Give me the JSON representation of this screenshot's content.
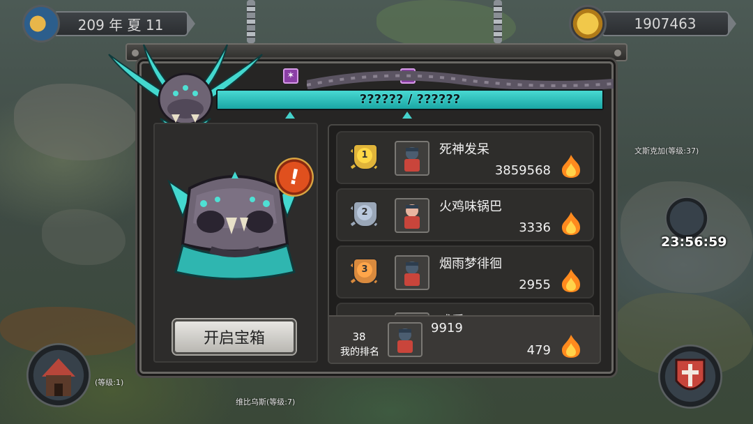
{
  "hud": {
    "date": "209 年 夏 11",
    "gold": "1907463",
    "season_icon": "sun-moon-icon",
    "gold_icon": "gold-coin-icon"
  },
  "boss": {
    "hp_text": "?????? / ??????",
    "hp_fraction": 1.0,
    "buff_icons": [
      "purple-buff-icon",
      "purple-buff-icon"
    ]
  },
  "chest": {
    "open_button": "开启宝箱",
    "alert_icon": "exclamation-icon"
  },
  "leaderboard": {
    "rows": [
      {
        "rank": "1",
        "name": "死神发呆",
        "score": "3859568",
        "medal": "gold"
      },
      {
        "rank": "2",
        "name": "火鸡味锅巴",
        "score": "3336",
        "medal": "silver"
      },
      {
        "rank": "3",
        "name": "烟雨梦徘徊",
        "score": "2955",
        "medal": "bronze"
      },
      {
        "rank": "",
        "name": "戒爱",
        "score": "",
        "medal": "grey"
      }
    ],
    "mine": {
      "rank": "38",
      "rank_label": "我的排名",
      "name": "9919",
      "score": "479"
    }
  },
  "world": {
    "timer": "23:56:59",
    "npc_labels": [
      "文斯克加(等级:37)",
      "(等级:1)",
      "维比乌斯(等级:7)"
    ]
  },
  "colors": {
    "teal": "#45d2cc",
    "gold_medal": "#e0b43a",
    "silver_medal": "#9aa7b8",
    "bronze_medal": "#d98a3e",
    "flame": "#ff8a1e"
  }
}
